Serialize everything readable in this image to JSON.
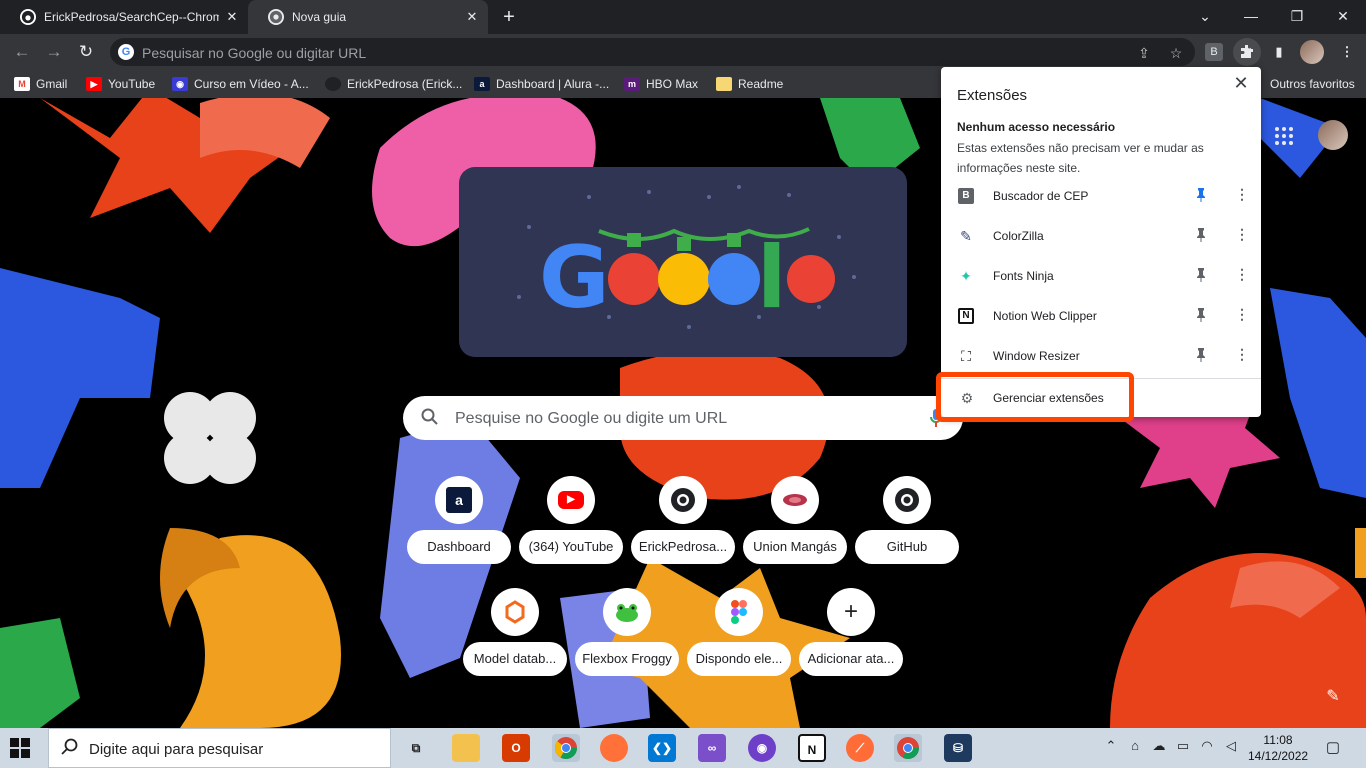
{
  "tabs": [
    {
      "title": "ErickPedrosa/SearchCep--Chrom",
      "icon": "github-icon",
      "active": false
    },
    {
      "title": "Nova guia",
      "icon": "chrome-icon",
      "active": true
    }
  ],
  "toolbar": {
    "omnibox_placeholder": "Pesquisar no Google ou digitar URL",
    "extension_badge": "B"
  },
  "bookmarks": [
    {
      "label": "Gmail",
      "icon": "gmail-icon"
    },
    {
      "label": "YouTube",
      "icon": "youtube-icon"
    },
    {
      "label": "Curso em Vídeo - A...",
      "icon": "cursoemvideo-icon"
    },
    {
      "label": "ErickPedrosa (Erick...",
      "icon": "github-icon"
    },
    {
      "label": "Dashboard | Alura -...",
      "icon": "alura-icon"
    },
    {
      "label": "HBO Max",
      "icon": "hbomax-icon"
    },
    {
      "label": "Readme",
      "icon": "folder-icon"
    }
  ],
  "other_bookmarks": "Outros favoritos",
  "search": {
    "placeholder": "Pesquise no Google ou digite um URL"
  },
  "shortcuts": [
    {
      "label": "Dashboard",
      "icon": "alura-icon",
      "glyph": "a"
    },
    {
      "label": "(364) YouTube",
      "icon": "youtube-icon",
      "glyph": "▶"
    },
    {
      "label": "ErickPedrosa...",
      "icon": "github-icon",
      "glyph": ""
    },
    {
      "label": "Union Mangás",
      "icon": "union-mangas-icon",
      "glyph": ""
    },
    {
      "label": "GitHub",
      "icon": "github-icon",
      "glyph": ""
    },
    {
      "label": "Model datab...",
      "icon": "model-icon",
      "glyph": ""
    },
    {
      "label": "Flexbox Froggy",
      "icon": "frog-icon",
      "glyph": ""
    },
    {
      "label": "Dispondo ele...",
      "icon": "figma-icon",
      "glyph": ""
    },
    {
      "label": "Adicionar ata...",
      "icon": "plus-icon",
      "glyph": "+"
    }
  ],
  "extensions_popup": {
    "title": "Extensões",
    "subtitle": "Nenhum acesso necessário",
    "description": "Estas extensões não precisam ver e mudar as informações neste site.",
    "items": [
      {
        "name": "Buscador de CEP",
        "icon": "b-badge-icon",
        "glyph": "B",
        "pinned": true
      },
      {
        "name": "ColorZilla",
        "icon": "eyedropper-icon",
        "glyph": "✎",
        "pinned": false
      },
      {
        "name": "Fonts Ninja",
        "icon": "ninja-icon",
        "glyph": "✦",
        "pinned": false
      },
      {
        "name": "Notion Web Clipper",
        "icon": "notion-icon",
        "glyph": "N",
        "pinned": false
      },
      {
        "name": "Window Resizer",
        "icon": "resize-icon",
        "glyph": "⛶",
        "pinned": false
      }
    ],
    "manage": "Gerenciar extensões"
  },
  "taskbar": {
    "search_placeholder": "Digite aqui para pesquisar",
    "time": "11:08",
    "date": "14/12/2022"
  },
  "colors": {
    "accent": "#1a73e8",
    "highlight": "#ff4500",
    "chrome_dark": "#35363a"
  }
}
